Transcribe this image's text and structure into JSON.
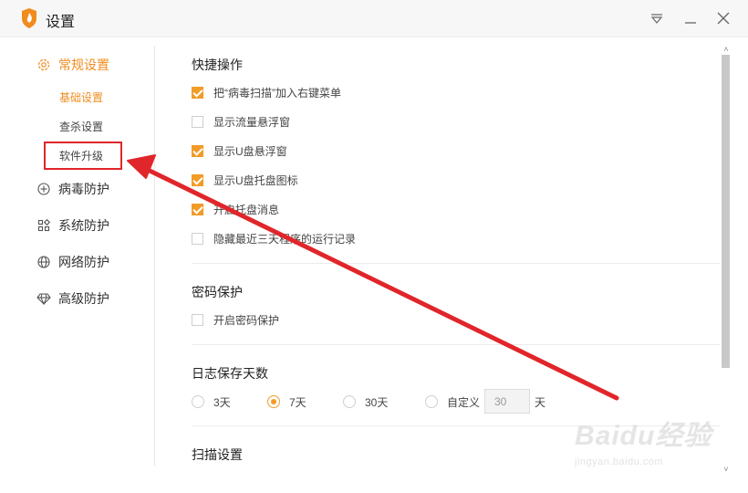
{
  "window": {
    "title": "设置"
  },
  "sidebar": {
    "general": {
      "label": "常规设置",
      "sub": [
        "基础设置",
        "查杀设置",
        "软件升级"
      ]
    },
    "items": [
      {
        "label": "病毒防护",
        "icon": "plus-circle-icon"
      },
      {
        "label": "系统防护",
        "icon": "apps-grid-icon"
      },
      {
        "label": "网络防护",
        "icon": "globe-icon"
      },
      {
        "label": "高级防护",
        "icon": "diamond-icon"
      }
    ]
  },
  "shortcut": {
    "title": "快捷操作",
    "options": [
      {
        "label": "把“病毒扫描”加入右键菜单",
        "checked": true
      },
      {
        "label": "显示流量悬浮窗",
        "checked": false
      },
      {
        "label": "显示U盘悬浮窗",
        "checked": true
      },
      {
        "label": "显示U盘托盘图标",
        "checked": true
      },
      {
        "label": "开启托盘消息",
        "checked": true
      },
      {
        "label": "隐藏最近三天程序的运行记录",
        "checked": false
      }
    ]
  },
  "password": {
    "title": "密码保护",
    "option": {
      "label": "开启密码保护",
      "checked": false
    }
  },
  "log": {
    "title": "日志保存天数",
    "options": [
      {
        "label": "3天",
        "selected": false
      },
      {
        "label": "7天",
        "selected": true
      },
      {
        "label": "30天",
        "selected": false
      },
      {
        "label": "自定义",
        "selected": false
      }
    ],
    "custom_value": "30",
    "unit": "天"
  },
  "scan": {
    "title": "扫描设置"
  },
  "watermark": {
    "main": "Baidu经验",
    "sub": "jingyan.baidu.com"
  },
  "colors": {
    "accent": "#f29b28",
    "annotation": "#e0262a"
  }
}
